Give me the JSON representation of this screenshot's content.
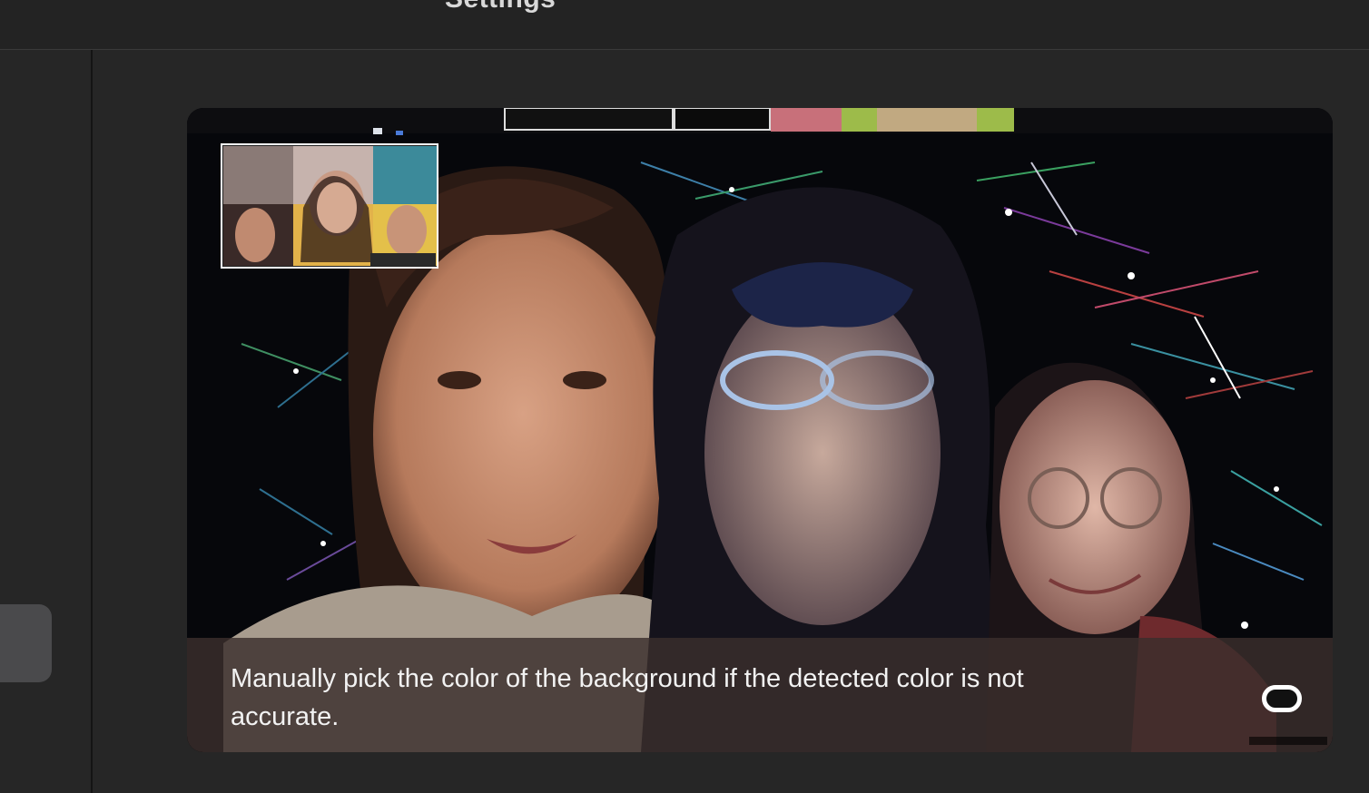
{
  "window": {
    "title": "Settings"
  },
  "preview": {
    "hint_text": "Manually pick the color of the background if the detected color is not accurate.",
    "picker_icon": "color-picker-icon"
  },
  "colors": {
    "window_bg": "#262626",
    "titlebar_bg": "#232323",
    "sidebar_selected": "#4a4a4c",
    "hint_bar": "#3a2e2c",
    "hint_text": "#f2f2f2"
  }
}
